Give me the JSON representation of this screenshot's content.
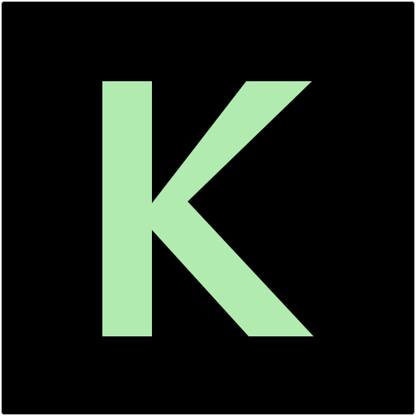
{
  "icon": {
    "letter": "K",
    "icon_name": "letter-k-icon",
    "colors": {
      "background": "#000000",
      "letter": "#b1ebb0",
      "border": "#ffffff"
    }
  }
}
